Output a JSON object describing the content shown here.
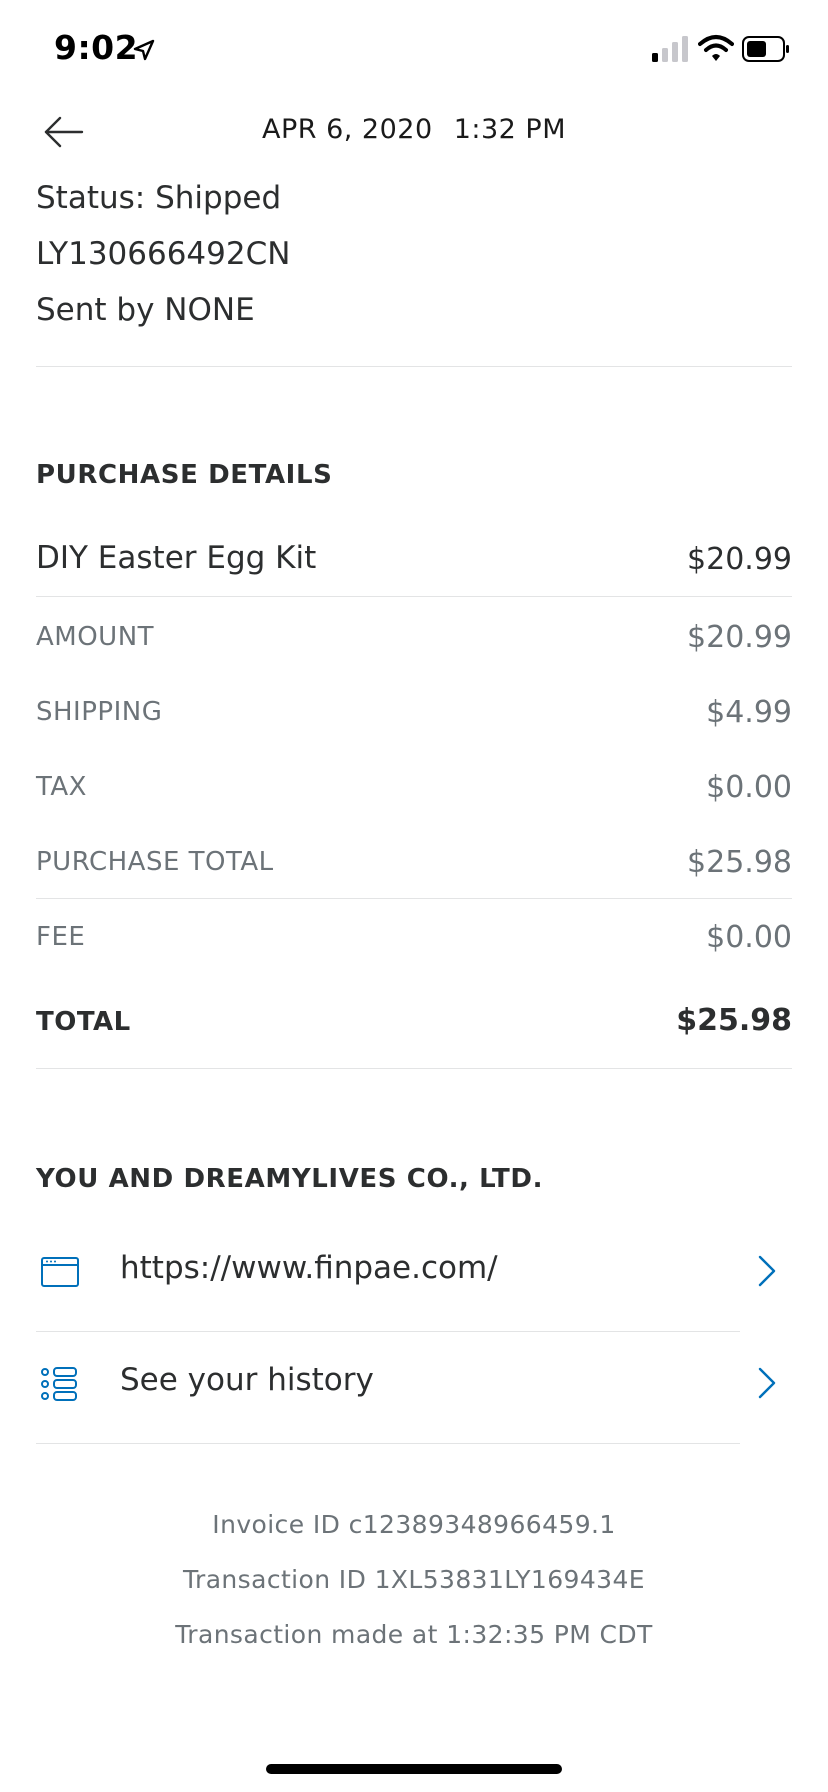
{
  "status_bar": {
    "time": "9:02"
  },
  "header": {
    "date": "APR 6, 2020",
    "time": "1:32 PM"
  },
  "shipment": {
    "status": "Status: Shipped",
    "tracking": "LY130666492CN",
    "sent_by": "Sent by NONE"
  },
  "purchase": {
    "title": "PURCHASE DETAILS",
    "item": {
      "name": "DIY Easter Egg Kit",
      "price": "$20.99"
    },
    "rows": [
      {
        "label": "AMOUNT",
        "value": "$20.99"
      },
      {
        "label": "SHIPPING",
        "value": "$4.99"
      },
      {
        "label": "TAX",
        "value": "$0.00"
      },
      {
        "label": "PURCHASE TOTAL",
        "value": "$25.98"
      },
      {
        "label": "FEE",
        "value": "$0.00"
      }
    ],
    "total": {
      "label": "TOTAL",
      "value": "$25.98"
    }
  },
  "merchant": {
    "title": "YOU AND DREAMYLIVES CO., LTD.",
    "website": "https://www.finpae.com/",
    "history": "See your history"
  },
  "footer": {
    "invoice": "Invoice ID c12389348966459.1",
    "transaction": "Transaction ID 1XL53831LY169434E",
    "made_at": "Transaction made at 1:32:35 PM CDT"
  },
  "colors": {
    "accent": "#0070ba",
    "text": "#2c2e2f",
    "muted": "#6c7378"
  }
}
